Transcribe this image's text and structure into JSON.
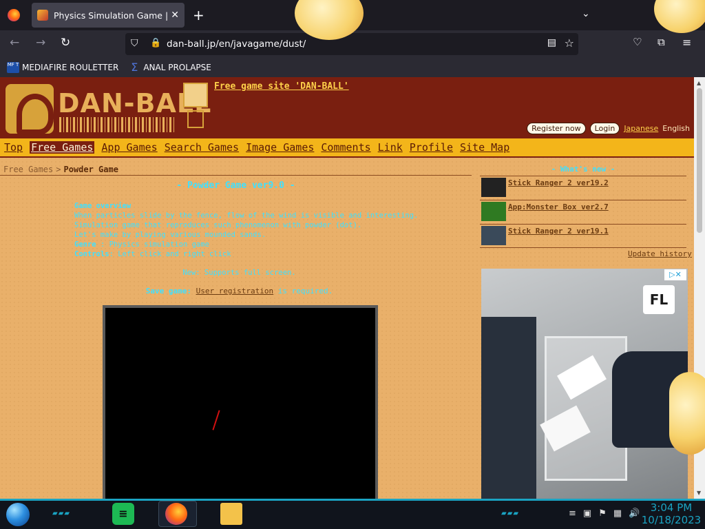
{
  "browser": {
    "tab_title": "Physics Simulation Game | Pow",
    "tab_close": "✕",
    "new_tab": "+",
    "tab_list": "⌄",
    "url": "dan-ball.jp/en/javagame/dust/",
    "bookmarks": [
      {
        "icon_text": "MF T",
        "label": "MEDIAFIRE ROULETTER"
      },
      {
        "icon_text": "Σ",
        "label": "ANAL PROLAPSE"
      }
    ]
  },
  "site": {
    "logo_text": "DAN-BALL",
    "title_link": "Free game site 'DAN-BALL'",
    "register": "Register now",
    "login": "Login",
    "japanese": "Japanese",
    "english": "English",
    "nav": [
      "Top",
      "Free Games",
      "App Games",
      "Search Games",
      "Image Games",
      "Comments",
      "Link",
      "Profile",
      "Site Map"
    ],
    "breadcrumb": {
      "home": "Free Games",
      "sep": ">",
      "current": "Powder Game"
    }
  },
  "game": {
    "title": "- Powder Game ver9.0 -",
    "overview_label": "Game overview",
    "overview_lines": [
      "When particles slide by the fence, flow of the wind is visible and interesting.",
      "Simulation game that reproduces such phenomenon with powder (dot).",
      "Let's make by playing various mounded sands."
    ],
    "genre_label": "Genre",
    "genre_value": ": Physics simulation game",
    "controls_label": "Controls",
    "controls_value": ": Left click and right click",
    "note": "New: Supports full screen.",
    "save_label": "Save game:",
    "save_link": "User registration",
    "save_suffix": "is required."
  },
  "sidebar": {
    "whats_new": "- What's new -",
    "news": [
      "Stick Ranger 2 ver19.2",
      "App:Monster Box ver2.7",
      "Stick Ranger 2 ver19.1"
    ],
    "update_history": "Update history",
    "ad_logo": "FL",
    "ad_choices": "▷✕"
  },
  "taskbar": {
    "spotify_glyph": "≡",
    "clock_time": "3:04 PM",
    "clock_date": "10/18/2023"
  },
  "colors": {
    "header": "#7a1f10",
    "nav": "#f3b51a",
    "accent_text": "#3fe0ff",
    "page_bg": "#e9b06a"
  }
}
